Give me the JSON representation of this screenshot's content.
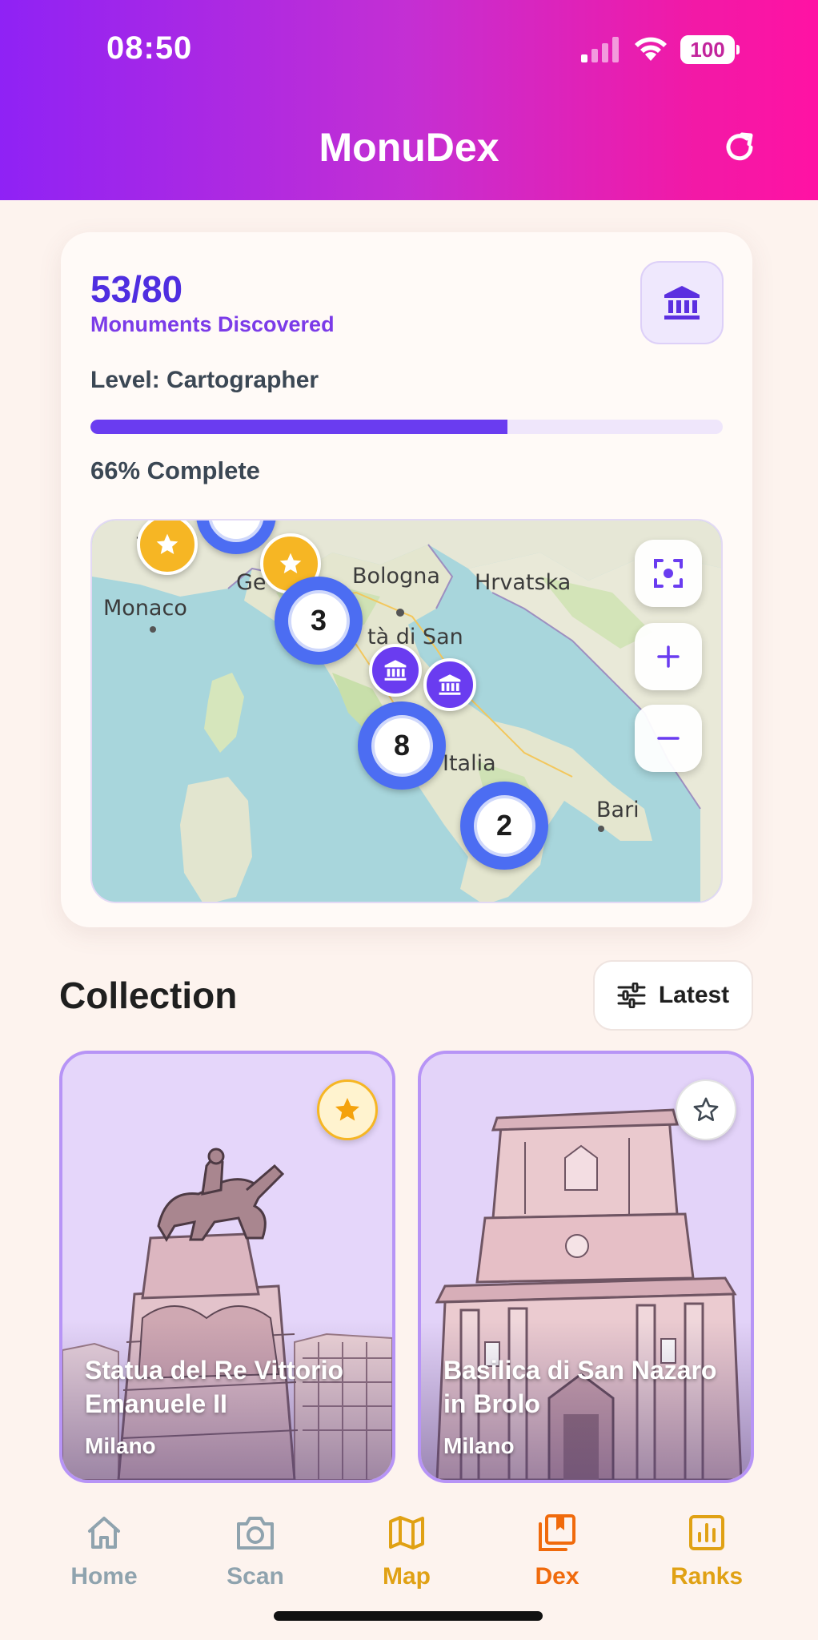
{
  "status_bar": {
    "time": "08:50",
    "battery": "100"
  },
  "header": {
    "title": "MonuDex",
    "refresh_icon": "refresh-icon"
  },
  "progress": {
    "count": "53/80",
    "count_label": "Monuments Discovered",
    "level": "Level: Cartographer",
    "percent_value": 0.66,
    "percent_text": "66% Complete"
  },
  "map": {
    "labels": [
      "Bologna",
      "Hrvatska",
      "Monaco",
      "Ge",
      "Italia",
      "Bari",
      "tà di San",
      "To"
    ],
    "clusters": [
      "3",
      "8",
      "2"
    ],
    "controls": {
      "recenter": "recenter-icon",
      "zoom_in": "+",
      "zoom_out": "−"
    }
  },
  "collection": {
    "title": "Collection",
    "sort_label": "Latest",
    "items": [
      {
        "name": "Statua del Re Vittorio Emanuele II",
        "city": "Milano",
        "favorite": true
      },
      {
        "name": "Basilica di San Nazaro in Brolo",
        "city": "Milano",
        "favorite": false
      }
    ]
  },
  "nav": {
    "items": [
      {
        "label": "Home",
        "icon": "home-icon"
      },
      {
        "label": "Scan",
        "icon": "camera-icon"
      },
      {
        "label": "Map",
        "icon": "map-icon"
      },
      {
        "label": "Dex",
        "icon": "dex-icon"
      },
      {
        "label": "Ranks",
        "icon": "chart-icon"
      }
    ]
  },
  "colors": {
    "accent": "#6a3cf0",
    "header_gradient_start": "#8f22f5",
    "header_gradient_end": "#ff12a4",
    "nav_active": "#f06a0c",
    "nav_inactive": "#8fa3ae",
    "nav_gold": "#e0a114"
  }
}
